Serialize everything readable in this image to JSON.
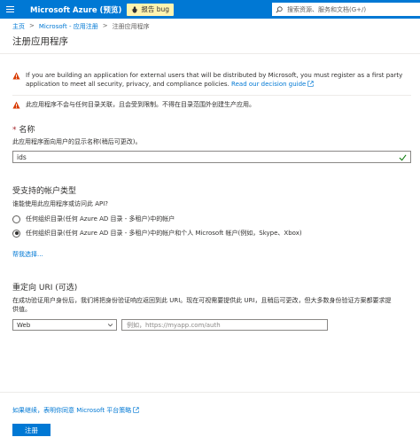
{
  "topbar": {
    "brand": "Microsoft Azure (预览)",
    "bug_label": "报告 bug",
    "search_placeholder": "搜索资源、服务和文档(G+/)"
  },
  "breadcrumb": {
    "home": "主页",
    "sep": ">",
    "app_reg": "Microsoft - 应用注册",
    "current": "注册应用程序"
  },
  "page": {
    "title": "注册应用程序"
  },
  "warnings": {
    "external_text": "If you are building an application for external users that will be distributed by Microsoft, you must register as a first party application to meet all security, privacy, and compliance policies.",
    "external_link": "Read our decision guide",
    "note_text": "此应用程序不会与任何目录关联，且会受到限制。不得在目录范围外创建生产应用。"
  },
  "name_section": {
    "required_mark": "*",
    "label": "名称",
    "description": "此应用程序面向用户的显示名称(稍后可更改)。",
    "value": "ids"
  },
  "account_types": {
    "heading": "受支持的帐户类型",
    "question": "谁能使用此应用程序或访问此 API?",
    "options": [
      {
        "label": "任何组织目录(任何 Azure AD 目录 - 多租户)中的帐户",
        "selected": false
      },
      {
        "label": "任何组织目录(任何 Azure AD 目录 - 多租户)中的帐户和个人 Microsoft 帐户(例如，Skype、Xbox)",
        "selected": true
      }
    ],
    "help_link": "帮我选择..."
  },
  "redirect": {
    "heading": "重定向 URI (可选)",
    "description_line1": "在成功验证用户身份后，我们将把身份验证响应返回到此 URI。现在可视需要提供此 URI，且稍后可更改，但大多数身份验证方案都要求提",
    "description_line2": "供值。",
    "platform_value": "Web",
    "uri_placeholder": "例如，https://myapp.com/auth"
  },
  "footer": {
    "policy_text": "如果继续，表明你同意 Microsoft 平台策略",
    "register_label": "注册"
  },
  "colors": {
    "accent": "#0078d4",
    "bug_button": "#fff4b0",
    "warning_icon": "#d83b01",
    "success_check": "#107c10"
  }
}
